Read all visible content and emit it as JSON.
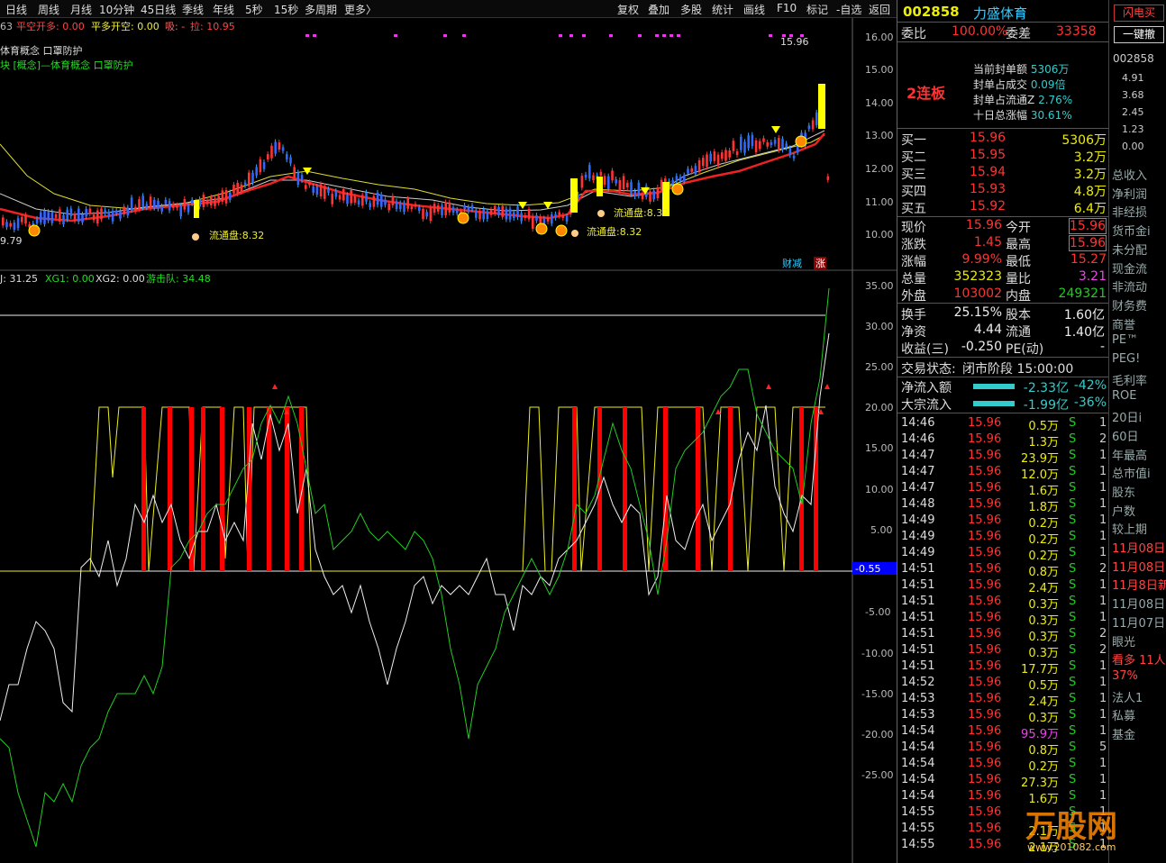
{
  "toolbar": {
    "left": [
      "日线",
      "周线",
      "月线",
      "10分钟",
      "45日线",
      "季线",
      "年线",
      "5秒",
      "15秒",
      "多周期",
      "更多〉"
    ],
    "right": [
      "复权",
      "叠加",
      "多股",
      "统计",
      "画线",
      "F10",
      "标记",
      "-自选",
      "返回"
    ]
  },
  "main": {
    "legend_a": "63",
    "legend_b": "平空开多: 0.00",
    "legend_c": "平多开空: 0.00",
    "legend_d": "吸: -",
    "legend_e": "拉: 10.95",
    "concept1": "体育概念 口罩防护",
    "concept2": "块   [概念]—体育概念 口罩防护",
    "high_label": "15.96",
    "low_label": "9.79",
    "float1": "流通盘:8.32",
    "float2": "流通盘:8.32",
    "float3": "流通盘:8.32",
    "axis": [
      "16.00",
      "15.00",
      "14.00",
      "13.00",
      "12.00",
      "11.00",
      "10.00"
    ],
    "badge1": "财减",
    "badge2": "涨"
  },
  "sub": {
    "legend_a": "J: 31.25",
    "legend_b": "XG1: 0.00",
    "legend_c": "XG2: 0.00",
    "legend_d": "游击队: 34.48",
    "axis": [
      "35.00",
      "30.00",
      "25.00",
      "20.00",
      "15.00",
      "10.00",
      "5.00",
      "-5.00",
      "-10.00",
      "-15.00",
      "-20.00",
      "-25.00"
    ],
    "current": "-0.55"
  },
  "stock": {
    "code": "002858",
    "name": "力盛体育",
    "buy_btn": "闪电买",
    "cancel_btn": "一键撤"
  },
  "ratio": {
    "l1": "委比",
    "v1": "100.00%",
    "l2": "委差",
    "v2": "33358"
  },
  "seal": {
    "tag": "2连板",
    "rows": [
      [
        "当前封单额",
        "5306万"
      ],
      [
        "封单占成交",
        "0.09倍"
      ],
      [
        "封单占流通Z",
        "2.76%"
      ],
      [
        "十日总涨幅",
        "30.61%"
      ]
    ]
  },
  "bids": [
    [
      "买一",
      "15.96",
      "5306万"
    ],
    [
      "买二",
      "15.95",
      "3.2万"
    ],
    [
      "买三",
      "15.94",
      "3.2万"
    ],
    [
      "买四",
      "15.93",
      "4.8万"
    ],
    [
      "买五",
      "15.92",
      "6.4万"
    ]
  ],
  "quote": [
    [
      "现价",
      "15.96",
      "今开",
      "15.96"
    ],
    [
      "涨跌",
      "1.45",
      "最高",
      "15.96"
    ],
    [
      "涨幅",
      "9.99%",
      "最低",
      "15.27"
    ],
    [
      "总量",
      "352323",
      "量比",
      "3.21"
    ],
    [
      "外盘",
      "103002",
      "内盘",
      "249321"
    ]
  ],
  "fund": [
    [
      "换手",
      "25.15%",
      "股本",
      "1.60亿"
    ],
    [
      "净资",
      "4.44",
      "流通",
      "1.40亿"
    ],
    [
      "收益(三)",
      "-0.250",
      "PE(动)",
      "-"
    ]
  ],
  "status": {
    "label": "交易状态:",
    "value": "闭市阶段 15:00:00"
  },
  "flow": [
    [
      "净流入额",
      "-2.33亿",
      "-42%"
    ],
    [
      "大宗流入",
      "-1.99亿",
      "-36%"
    ]
  ],
  "ticks": [
    [
      "14:46",
      "15.96",
      "0.5万",
      "S",
      "1"
    ],
    [
      "14:46",
      "15.96",
      "1.3万",
      "S",
      "2"
    ],
    [
      "14:47",
      "15.96",
      "23.9万",
      "S",
      "1"
    ],
    [
      "14:47",
      "15.96",
      "12.0万",
      "S",
      "1"
    ],
    [
      "14:47",
      "15.96",
      "1.6万",
      "S",
      "1"
    ],
    [
      "14:48",
      "15.96",
      "1.8万",
      "S",
      "1"
    ],
    [
      "14:49",
      "15.96",
      "0.2万",
      "S",
      "1"
    ],
    [
      "14:49",
      "15.96",
      "0.2万",
      "S",
      "1"
    ],
    [
      "14:49",
      "15.96",
      "0.2万",
      "S",
      "1"
    ],
    [
      "14:51",
      "15.96",
      "0.8万",
      "S",
      "2"
    ],
    [
      "14:51",
      "15.96",
      "2.4万",
      "S",
      "1"
    ],
    [
      "14:51",
      "15.96",
      "0.3万",
      "S",
      "1"
    ],
    [
      "14:51",
      "15.96",
      "0.3万",
      "S",
      "1"
    ],
    [
      "14:51",
      "15.96",
      "0.3万",
      "S",
      "2"
    ],
    [
      "14:51",
      "15.96",
      "0.3万",
      "S",
      "2"
    ],
    [
      "14:51",
      "15.96",
      "17.7万",
      "S",
      "1"
    ],
    [
      "14:52",
      "15.96",
      "0.5万",
      "S",
      "1"
    ],
    [
      "14:53",
      "15.96",
      "2.4万",
      "S",
      "1"
    ],
    [
      "14:53",
      "15.96",
      "0.3万",
      "S",
      "1"
    ],
    [
      "14:54",
      "15.96",
      "95.9万",
      "S",
      "1"
    ],
    [
      "14:54",
      "15.96",
      "0.8万",
      "S",
      "5"
    ],
    [
      "14:54",
      "15.96",
      "0.2万",
      "S",
      "1"
    ],
    [
      "14:54",
      "15.96",
      "27.3万",
      "S",
      "1"
    ],
    [
      "14:54",
      "15.96",
      "1.6万",
      "S",
      "1"
    ],
    [
      "14:55",
      "15.96",
      "",
      "S",
      "1"
    ],
    [
      "14:55",
      "15.96",
      "2.1万",
      "S",
      "1"
    ],
    [
      "14:55",
      "15.96",
      "2.1万",
      "S",
      "1"
    ]
  ],
  "far": {
    "code": "002858",
    "axis": [
      "4.91",
      "3.68",
      "2.45",
      "1.23",
      "0.00"
    ],
    "items": [
      "总收入",
      "净利润",
      "非经损",
      "货币金i",
      "未分配",
      "现金流",
      "非流动",
      "财务费",
      "商誉",
      "PE™",
      "PEG!",
      "毛利率",
      "ROE",
      "20日i",
      "60日",
      "年最高",
      "总市值i",
      "股东",
      "户数",
      "较上期",
      "11月08日",
      "11月08日",
      "11月8日新",
      "11月08日",
      "11月07日",
      "眼光",
      "看多 11人",
      "37%",
      "法人1",
      "私募",
      "基金"
    ]
  },
  "watermark": "万股网",
  "watermark_url": "www.201082.com"
}
